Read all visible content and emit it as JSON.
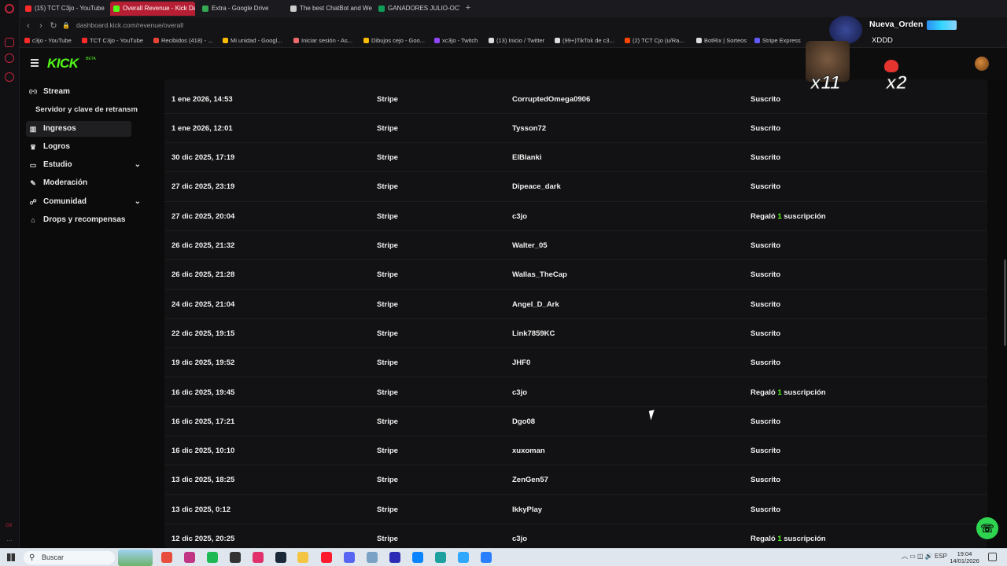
{
  "browser": {
    "tabs": [
      {
        "label": "(15) TCT C3jo - YouTube",
        "fav_color": "#ff2a2a",
        "active": false
      },
      {
        "label": "Overall Revenue - Kick Da",
        "fav_color": "#53fc18",
        "active": true
      },
      {
        "label": "Extra - Google Drive",
        "fav_color": "#34a853",
        "active": false
      },
      {
        "label": "The best ChatBot and Web",
        "fav_color": "#cccccc",
        "active": false
      },
      {
        "label": "GANADORES JULIO-OCT",
        "fav_color": "#0f9d58",
        "active": false
      }
    ],
    "url": "dashboard.kick.com/revenue/overall",
    "bookmarks": [
      {
        "label": "c3jo - YouTube",
        "color": "#ff2a2a"
      },
      {
        "label": "TCT C3jo - YouTube",
        "color": "#ff2a2a"
      },
      {
        "label": "Recibidos (418) - ...",
        "color": "#ea4335"
      },
      {
        "label": "Mi unidad - Googl...",
        "color": "#fbbc04"
      },
      {
        "label": "Iniciar sesión - As...",
        "color": "#f06a6a"
      },
      {
        "label": "Dibujos cejo - Goo...",
        "color": "#fbbc04"
      },
      {
        "label": "xc3jo - Twitch",
        "color": "#9146ff"
      },
      {
        "label": "(13) Inicio / Twitter",
        "color": "#dddddd"
      },
      {
        "label": "(99+)TikTok de c3...",
        "color": "#dddddd"
      },
      {
        "label": "(2) TCT Cjo (u/Ra...",
        "color": "#ff4500"
      },
      {
        "label": "BotRix | Sorteos",
        "color": "#dddddd"
      },
      {
        "label": "Stripe Express",
        "color": "#635bff"
      }
    ]
  },
  "kick": {
    "logo": "KICK",
    "logo_tag": "BETA"
  },
  "sidebar": {
    "items": [
      {
        "label": "Stream",
        "icon": "broadcast-icon",
        "glyph": "((•))"
      },
      {
        "label": "Servidor y clave de retransm",
        "icon": "",
        "glyph": ""
      },
      {
        "label": "Ingresos",
        "icon": "chart-icon",
        "glyph": "▥"
      },
      {
        "label": "Logros",
        "icon": "trophy-icon",
        "glyph": "🏆"
      },
      {
        "label": "Estudio",
        "icon": "monitor-icon",
        "glyph": "▭"
      },
      {
        "label": "Moderación",
        "icon": "wrench-icon",
        "glyph": "🔧"
      },
      {
        "label": "Comunidad",
        "icon": "users-icon",
        "glyph": "☍"
      },
      {
        "label": "Drops y recompensas",
        "icon": "gift-icon",
        "glyph": "⌂"
      }
    ]
  },
  "table": {
    "rows": [
      {
        "date": "1 ene 2026, 14:53",
        "method": "Stripe",
        "user": "CorruptedOmega0906",
        "type": "Suscrito"
      },
      {
        "date": "1 ene 2026, 12:01",
        "method": "Stripe",
        "user": "Tysson72",
        "type": "Suscrito"
      },
      {
        "date": "30 dic 2025, 17:19",
        "method": "Stripe",
        "user": "ElBlanki",
        "type": "Suscrito"
      },
      {
        "date": "27 dic 2025, 23:19",
        "method": "Stripe",
        "user": "Dipeace_dark",
        "type": "Suscrito"
      },
      {
        "date": "27 dic 2025, 20:04",
        "method": "Stripe",
        "user": "c3jo",
        "type_pre": "Regaló",
        "type_num": "1",
        "type_post": "suscripción"
      },
      {
        "date": "26 dic 2025, 21:32",
        "method": "Stripe",
        "user": "Walter_05",
        "type": "Suscrito"
      },
      {
        "date": "26 dic 2025, 21:28",
        "method": "Stripe",
        "user": "Wallas_TheCap",
        "type": "Suscrito"
      },
      {
        "date": "24 dic 2025, 21:04",
        "method": "Stripe",
        "user": "Angel_D_Ark",
        "type": "Suscrito"
      },
      {
        "date": "22 dic 2025, 19:15",
        "method": "Stripe",
        "user": "Link7859KC",
        "type": "Suscrito"
      },
      {
        "date": "19 dic 2025, 19:52",
        "method": "Stripe",
        "user": "JHF0",
        "type": "Suscrito"
      },
      {
        "date": "16 dic 2025, 19:45",
        "method": "Stripe",
        "user": "c3jo",
        "type_pre": "Regaló",
        "type_num": "1",
        "type_post": "suscripción"
      },
      {
        "date": "16 dic 2025, 17:21",
        "method": "Stripe",
        "user": "Dgo08",
        "type": "Suscrito"
      },
      {
        "date": "16 dic 2025, 10:10",
        "method": "Stripe",
        "user": "xuxoman",
        "type": "Suscrito"
      },
      {
        "date": "13 dic 2025, 18:25",
        "method": "Stripe",
        "user": "ZenGen57",
        "type": "Suscrito"
      },
      {
        "date": "13 dic 2025, 0:12",
        "method": "Stripe",
        "user": "IkkyPlay",
        "type": "Suscrito"
      },
      {
        "date": "12 dic 2025, 20:25",
        "method": "Stripe",
        "user": "c3jo",
        "type_pre": "Regaló",
        "type_num": "1",
        "type_post": "suscripción"
      }
    ]
  },
  "overlay": {
    "username": "Nueva_Orden",
    "message": "XDDD",
    "emote1_count": "x11",
    "emote2_count": "x2"
  },
  "taskbar": {
    "search_placeholder": "Buscar",
    "language": "ESP",
    "time": "19:04",
    "date": "14/01/2026"
  },
  "colors": {
    "accent": "#53fc18",
    "active_tab": "#b61e34"
  }
}
